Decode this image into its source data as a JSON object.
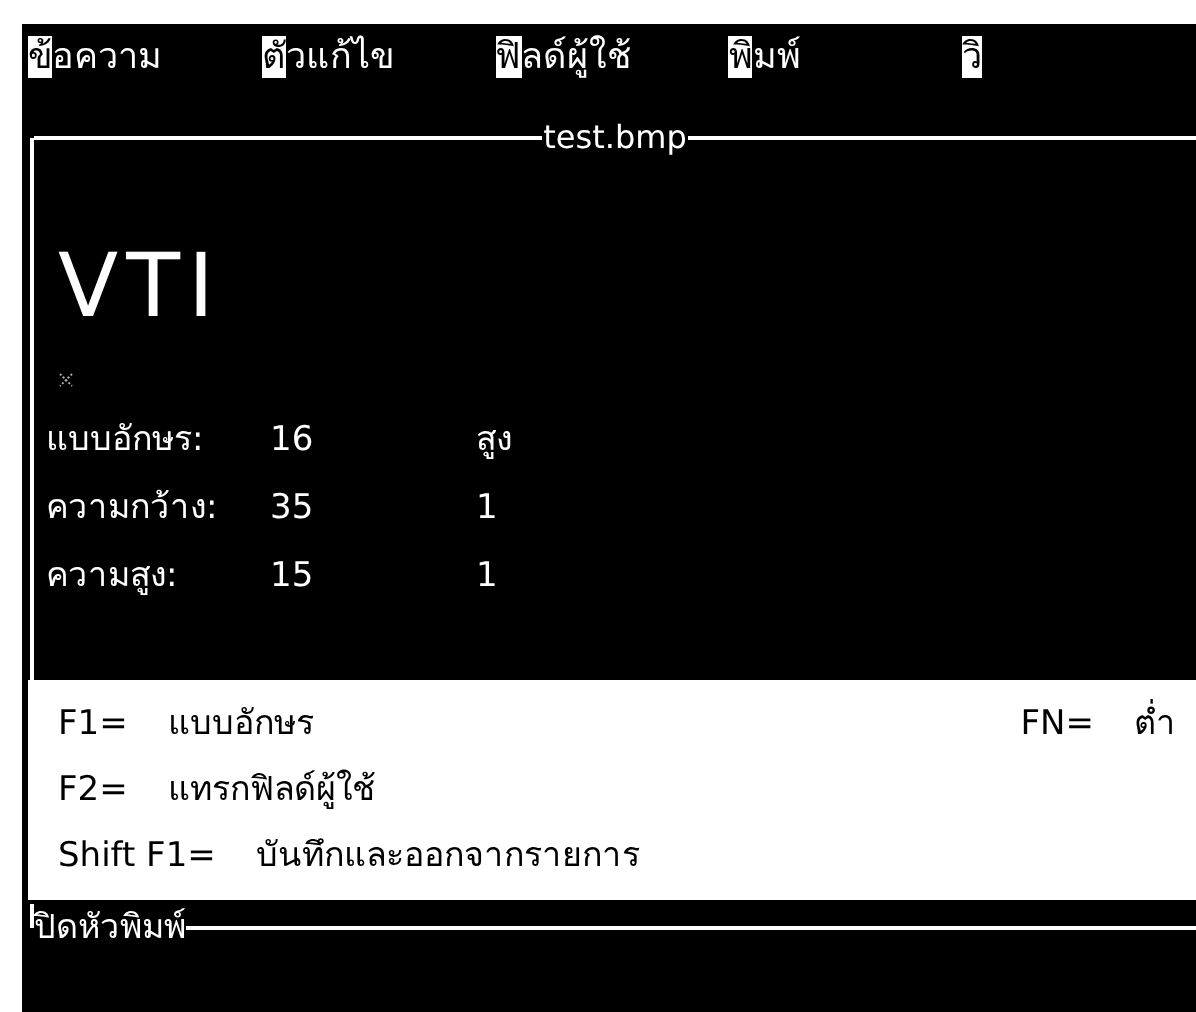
{
  "menu": [
    {
      "hotkey": "ข้",
      "rest": "อความ"
    },
    {
      "hotkey": "ตั",
      "rest": "วแก้ไข"
    },
    {
      "hotkey": "ฟิ",
      "rest": "ลด์ผู้ใช้"
    },
    {
      "hotkey": "พิ",
      "rest": "มพ์"
    },
    {
      "hotkey": "วิ"
    }
  ],
  "frame": {
    "title": "test.bmp",
    "logo": "VTI",
    "fields": [
      {
        "label": "แบบอักษร:",
        "value": "16",
        "extra": "สูง"
      },
      {
        "label": "ความกว้าง:",
        "value": "35",
        "extra": "1"
      },
      {
        "label": "ความสูง:",
        "value": "15",
        "extra": "1"
      }
    ]
  },
  "help": [
    {
      "key": "F1=",
      "action": "แบบอักษร",
      "side_key": "FN=",
      "side_action": "ต่ำ"
    },
    {
      "key": "F2=",
      "action": "แทรกฟิลด์ผู้ใช้"
    },
    {
      "key": "Shift  F1=",
      "action": "บันทึกและออกจากรายการ"
    }
  ],
  "status": "ปิดหัวพิมพ์"
}
